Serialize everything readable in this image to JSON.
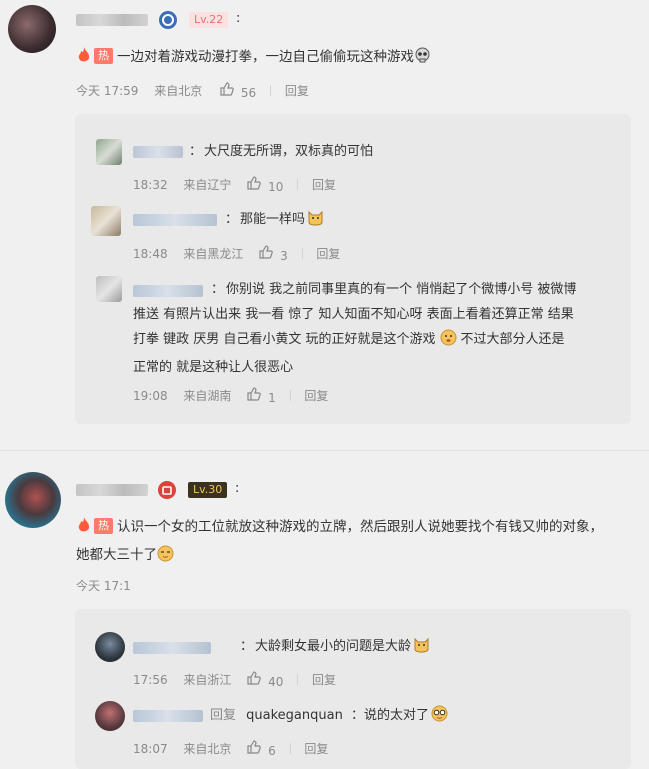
{
  "comments": [
    {
      "level": "Lv.22",
      "hot": "热",
      "text": "一边对着游戏动漫打拳，一边自己偷偷玩这种游戏",
      "time": "今天 17:59",
      "location": "来自北京",
      "likes": "56",
      "reply": "回复",
      "replies": [
        {
          "colon": "：",
          "text": "大尺度无所谓，双标真的可怕",
          "time": "18:32",
          "location": "来自辽宁",
          "likes": "10",
          "reply": "回复"
        },
        {
          "colon": "：",
          "text": "那能一样吗",
          "time": "18:48",
          "location": "来自黑龙江",
          "likes": "3",
          "reply": "回复"
        },
        {
          "colon": "：",
          "text_lines": [
            "你别说 我之前同事里真的有一个  悄悄起了个微博小号 被微博",
            "推送 有照片认出来 我一看 惊了 知人知面不知心呀  表面上看着还算正常 结果",
            "打拳 键政 厌男 自己看小黄文 玩的正好就是这个游戏",
            "正常的 就是这种让人很恶心"
          ],
          "text_after_emoji": "不过大部分人还是",
          "time": "19:08",
          "location": "来自湖南",
          "likes": "1",
          "reply": "回复"
        }
      ]
    },
    {
      "level": "Lv.30",
      "hot": "热",
      "text_lines": [
        "认识一个女的工位就放这种游戏的立牌，然后跟别人说她要找个有钱又帅的对象，",
        "她都大三十了"
      ],
      "time": "今天 17:1",
      "replies": [
        {
          "colon": "：",
          "text": "大龄剩女最小的问题是大龄",
          "time": "17:56",
          "location": "来自浙江",
          "likes": "40",
          "reply": "回复"
        },
        {
          "reply_prefix": "回复",
          "reply_to": "quakeganquan",
          "colon": "：",
          "text": "说的太对了",
          "time": "18:07",
          "location": "来自北京",
          "likes": "6",
          "reply": "回复"
        }
      ]
    }
  ],
  "colors": {
    "hot_red": "#ff5a3c",
    "lv22_bg": "#fbe1e1",
    "lv30_bg": "#3b3320",
    "link_blue": "#4a6fa5"
  }
}
